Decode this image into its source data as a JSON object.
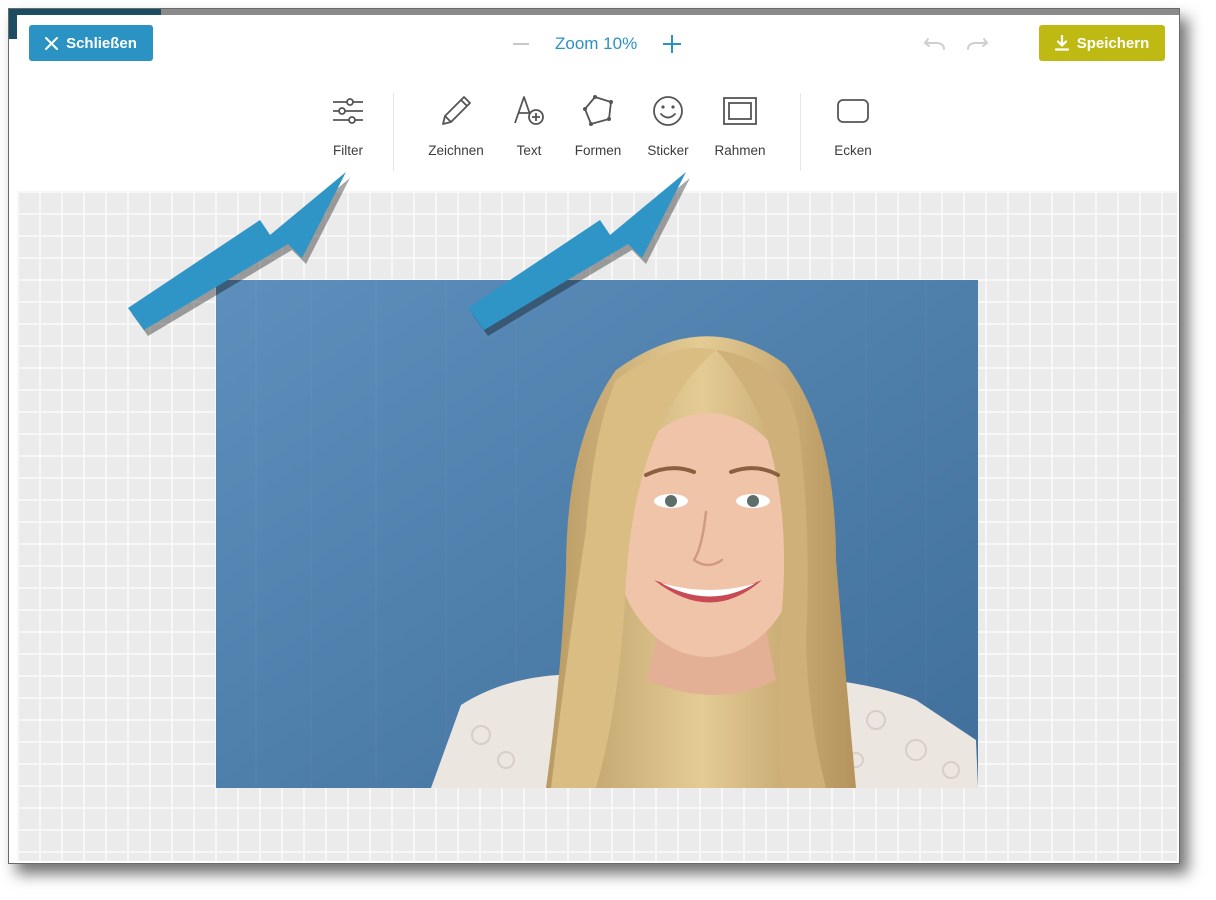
{
  "topbar": {
    "close_label": "Schließen",
    "zoom_label": "Zoom 10%",
    "save_label": "Speichern"
  },
  "toolbar": {
    "items": [
      {
        "label": "Filter",
        "icon": "sliders-icon"
      },
      {
        "label": "Zeichnen",
        "icon": "pencil-icon"
      },
      {
        "label": "Text",
        "icon": "text-add-icon"
      },
      {
        "label": "Formen",
        "icon": "polygon-icon"
      },
      {
        "label": "Sticker",
        "icon": "smiley-icon"
      },
      {
        "label": "Rahmen",
        "icon": "frame-icon"
      },
      {
        "label": "Ecken",
        "icon": "rounded-corner-icon"
      }
    ]
  },
  "colors": {
    "accent_blue": "#2b92c4",
    "save_green": "#bfba13",
    "annotation_arrow": "#2e95c6"
  }
}
